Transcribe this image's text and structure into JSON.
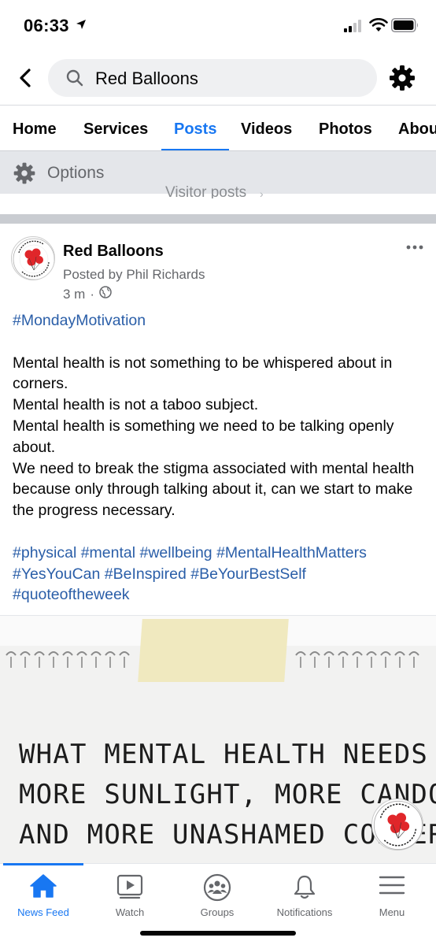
{
  "status_bar": {
    "time": "06:33"
  },
  "search": {
    "query": "Red Balloons"
  },
  "tabs": [
    {
      "label": "Home",
      "active": false
    },
    {
      "label": "Services",
      "active": false
    },
    {
      "label": "Posts",
      "active": true
    },
    {
      "label": "Videos",
      "active": false
    },
    {
      "label": "Photos",
      "active": false
    },
    {
      "label": "Abou",
      "active": false
    }
  ],
  "options": {
    "label": "Options",
    "peek_text": "Visitor posts"
  },
  "post": {
    "page_name": "Red Balloons",
    "posted_by": "Posted by Phil Richards",
    "time_ago": "3 m",
    "separator": "·",
    "audience_icon": "globe-icon",
    "hashtag_intro": "#MondayMotivation",
    "paragraph_lines": [
      "Mental health is not something to be whispered about in corners.",
      "Mental health is not a taboo subject.",
      "Mental health is something we need to be talking openly about.",
      "We need to break the stigma associated with mental health because only through talking about it, can we start to make the progress necessary."
    ],
    "hashtags_line1": "#physical #mental #wellbeing #MentalHealthMatters",
    "hashtags_line2": "#YesYouCan #BeInspired #BeYourBestSelf",
    "hashtags_line3": "#quoteoftheweek",
    "image_quote_lines": [
      "WHAT MENTAL HEALTH NEEDS IS",
      "MORE SUNLIGHT, MORE CANDOUR,",
      "AND MORE UNASHAMED CONVERSAT"
    ],
    "logo_text_top": "Red Balloons",
    "logo_text_bottom": "Physical and Mental Wellbeing"
  },
  "bottom_nav": [
    {
      "label": "News Feed",
      "icon": "home-icon",
      "active": true
    },
    {
      "label": "Watch",
      "icon": "watch-icon",
      "active": false
    },
    {
      "label": "Groups",
      "icon": "groups-icon",
      "active": false
    },
    {
      "label": "Notifications",
      "icon": "bell-icon",
      "active": false
    },
    {
      "label": "Menu",
      "icon": "menu-icon",
      "active": false
    }
  ],
  "colors": {
    "accent": "#1877f2",
    "hashtag": "#2a5ea8",
    "secondary_text": "#65676b",
    "balloon_red": "#e0262a"
  }
}
